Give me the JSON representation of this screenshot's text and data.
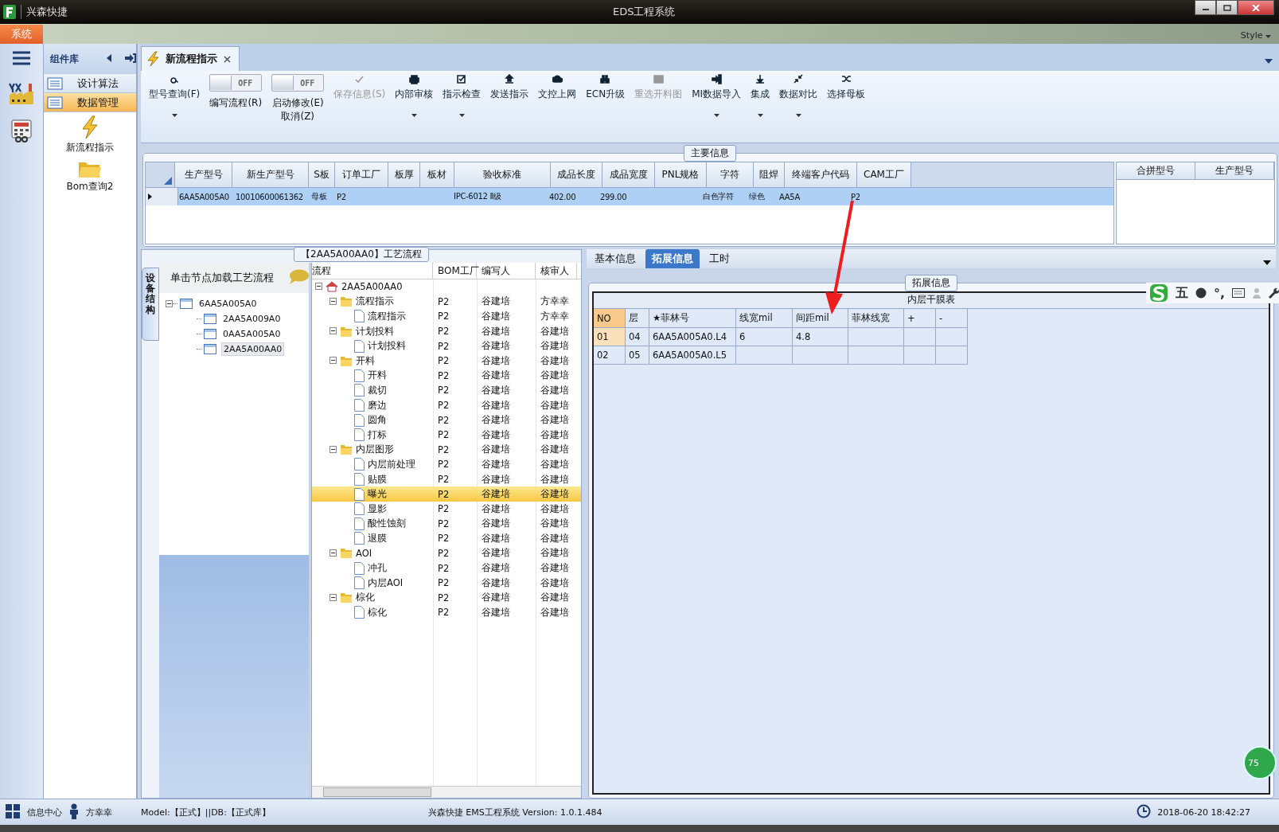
{
  "window": {
    "app_name": "兴森快捷",
    "title": "EDS工程系统"
  },
  "menu": [
    {
      "label": "系统",
      "selected": true
    }
  ],
  "style_menu": "Style",
  "component_panel": {
    "title": "组件库",
    "items": [
      {
        "label": "设计算法",
        "selected": false
      },
      {
        "label": "数据管理",
        "selected": true
      }
    ],
    "tools": [
      {
        "label": "新流程指示"
      },
      {
        "label": "Bom查询2"
      }
    ]
  },
  "doc_tab": {
    "label": "新流程指示"
  },
  "toolbar": [
    {
      "kind": "button",
      "label": "型号查询(F)",
      "disabled": false,
      "dropdown": true
    },
    {
      "kind": "toggle",
      "label": "编写流程(R)",
      "switch_text": "OFF",
      "on": false
    },
    {
      "kind": "toggle",
      "label": "启动修改(E)",
      "label_2": "取消(Z)",
      "switch_text": "OFF",
      "on": false
    },
    {
      "kind": "button",
      "label": "保存信息(S)",
      "disabled": true,
      "dropdown": false
    },
    {
      "kind": "button",
      "label": "内部审核",
      "disabled": false,
      "dropdown": true
    },
    {
      "kind": "button",
      "label": "指示检查",
      "disabled": false,
      "dropdown": true
    },
    {
      "kind": "button",
      "label": "发送指示",
      "disabled": false,
      "dropdown": false
    },
    {
      "kind": "button",
      "label": "文控上网",
      "disabled": false,
      "dropdown": false
    },
    {
      "kind": "button",
      "label": "ECN升级",
      "disabled": false,
      "dropdown": false
    },
    {
      "kind": "button",
      "label": "重选开料图",
      "disabled": true,
      "dropdown": false
    },
    {
      "kind": "button",
      "label": "MI数据导入",
      "disabled": false,
      "dropdown": true
    },
    {
      "kind": "button",
      "label": "集成",
      "disabled": false,
      "dropdown": true
    },
    {
      "kind": "button",
      "label": "数据对比",
      "disabled": false,
      "dropdown": true
    },
    {
      "kind": "button",
      "label": "选择母板",
      "disabled": false,
      "dropdown": false
    }
  ],
  "main_info": {
    "title": "主要信息",
    "columns": [
      "生产型号",
      "新生产型号",
      "S板",
      "订单工厂",
      "板厚",
      "板材",
      "验收标准",
      "成品长度",
      "成品宽度",
      "PNL规格",
      "字符",
      "阻焊",
      "终端客户代码",
      "CAM工厂"
    ],
    "rows": [
      {
        "selected": true,
        "cells": [
          "6AA5A005A0",
          "10010600061362",
          "母板",
          "P2",
          null,
          null,
          "IPC-6012 Ⅱ级",
          "402.00",
          "299.00",
          null,
          "白色字符",
          "绿色",
          "AA5A",
          "P2"
        ]
      }
    ],
    "side_columns": [
      "合拼型号",
      "生产型号"
    ]
  },
  "flow_section": {
    "title": "【2AA5A00AA0】工艺流程"
  },
  "structure_panel": {
    "side_tab": "设备结构",
    "header": "单击节点加载工艺流程",
    "tree": [
      {
        "label": "6AA5A005A0",
        "expanded": true,
        "selected": false,
        "children": [
          {
            "label": "2AA5A009A0",
            "selected": false
          },
          {
            "label": "0AA5A005A0",
            "selected": false
          },
          {
            "label": "2AA5A00AA0",
            "selected": true
          }
        ]
      }
    ]
  },
  "flow_grid": {
    "columns": [
      "流程",
      "BOM工厂",
      "编写人",
      "核审人"
    ],
    "tree": [
      {
        "kind": "root",
        "label": "2AA5A00AA0",
        "expanded": true,
        "selected": false,
        "children": [
          {
            "kind": "folder",
            "label": "流程指示",
            "factory": "P2",
            "writer": "谷建培",
            "reviewer": "方幸幸",
            "expanded": true,
            "selected": false,
            "children": [
              {
                "kind": "doc",
                "label": "流程指示",
                "factory": "P2",
                "writer": "谷建培",
                "reviewer": "方幸幸",
                "selected": false
              }
            ]
          },
          {
            "kind": "folder",
            "label": "计划投料",
            "factory": "P2",
            "writer": "谷建培",
            "reviewer": "谷建培",
            "expanded": true,
            "selected": false,
            "children": [
              {
                "kind": "doc",
                "label": "计划投料",
                "factory": "P2",
                "writer": "谷建培",
                "reviewer": "谷建培",
                "selected": false
              }
            ]
          },
          {
            "kind": "folder",
            "label": "开料",
            "factory": "P2",
            "writer": "谷建培",
            "reviewer": "谷建培",
            "expanded": true,
            "selected": false,
            "children": [
              {
                "kind": "doc",
                "label": "开料",
                "factory": "P2",
                "writer": "谷建培",
                "reviewer": "谷建培",
                "selected": false
              },
              {
                "kind": "doc",
                "label": "裁切",
                "factory": "P2",
                "writer": "谷建培",
                "reviewer": "谷建培",
                "selected": false
              },
              {
                "kind": "doc",
                "label": "磨边",
                "factory": "P2",
                "writer": "谷建培",
                "reviewer": "谷建培",
                "selected": false
              },
              {
                "kind": "doc",
                "label": "圆角",
                "factory": "P2",
                "writer": "谷建培",
                "reviewer": "谷建培",
                "selected": false
              },
              {
                "kind": "doc",
                "label": "打标",
                "factory": "P2",
                "writer": "谷建培",
                "reviewer": "谷建培",
                "selected": false
              }
            ]
          },
          {
            "kind": "folder",
            "label": "内层图形",
            "factory": "P2",
            "writer": "谷建培",
            "reviewer": "谷建培",
            "expanded": true,
            "selected": false,
            "children": [
              {
                "kind": "doc",
                "label": "内层前处理",
                "factory": "P2",
                "writer": "谷建培",
                "reviewer": "谷建培",
                "selected": false
              },
              {
                "kind": "doc",
                "label": "贴膜",
                "factory": "P2",
                "writer": "谷建培",
                "reviewer": "谷建培",
                "selected": false
              },
              {
                "kind": "doc",
                "label": "曝光",
                "factory": "P2",
                "writer": "谷建培",
                "reviewer": "谷建培",
                "selected": true
              },
              {
                "kind": "doc",
                "label": "显影",
                "factory": "P2",
                "writer": "谷建培",
                "reviewer": "谷建培",
                "selected": false
              },
              {
                "kind": "doc",
                "label": "酸性蚀刻",
                "factory": "P2",
                "writer": "谷建培",
                "reviewer": "谷建培",
                "selected": false
              },
              {
                "kind": "doc",
                "label": "退膜",
                "factory": "P2",
                "writer": "谷建培",
                "reviewer": "谷建培",
                "selected": false
              }
            ]
          },
          {
            "kind": "folder",
            "label": "AOI",
            "factory": "P2",
            "writer": "谷建培",
            "reviewer": "谷建培",
            "expanded": true,
            "selected": false,
            "children": [
              {
                "kind": "doc",
                "label": "冲孔",
                "factory": "P2",
                "writer": "谷建培",
                "reviewer": "谷建培",
                "selected": false
              },
              {
                "kind": "doc",
                "label": "内层AOI",
                "factory": "P2",
                "writer": "谷建培",
                "reviewer": "谷建培",
                "selected": false
              }
            ]
          },
          {
            "kind": "folder",
            "label": "棕化",
            "factory": "P2",
            "writer": "谷建培",
            "reviewer": "谷建培",
            "expanded": true,
            "selected": false,
            "children": [
              {
                "kind": "doc",
                "label": "棕化",
                "factory": "P2",
                "writer": "谷建培",
                "reviewer": "谷建培",
                "selected": false
              }
            ]
          }
        ]
      }
    ]
  },
  "detail_tabs": [
    {
      "label": "基本信息",
      "selected": false
    },
    {
      "label": "拓展信息",
      "selected": true
    },
    {
      "label": "工时",
      "selected": false
    }
  ],
  "ext_info": {
    "title": "拓展信息",
    "table_title": "内层干膜表",
    "columns": [
      "NO",
      "层",
      "★菲林号",
      "线宽mil",
      "间距mil",
      "菲林线宽",
      "+",
      "-"
    ],
    "rows": [
      {
        "selected": true,
        "cells": [
          "01",
          "04",
          "6AA5A005A0.L4",
          "6",
          "4.8",
          null,
          null,
          null
        ]
      },
      {
        "selected": false,
        "cells": [
          "02",
          "05",
          "6AA5A005A0.L5",
          null,
          null,
          null,
          null,
          null
        ]
      }
    ]
  },
  "ime_toolbar": {
    "mode": "五",
    "punctuation": "°,"
  },
  "floating_ball": "75",
  "status_bar": {
    "info_center": "信息中心",
    "user": "方幸幸",
    "model": "Model:【正式】||DB:【正式库】",
    "version": "兴森快捷 EMS工程系统 Version: 1.0.1.484",
    "datetime": "2018-06-20 18:42:27"
  }
}
